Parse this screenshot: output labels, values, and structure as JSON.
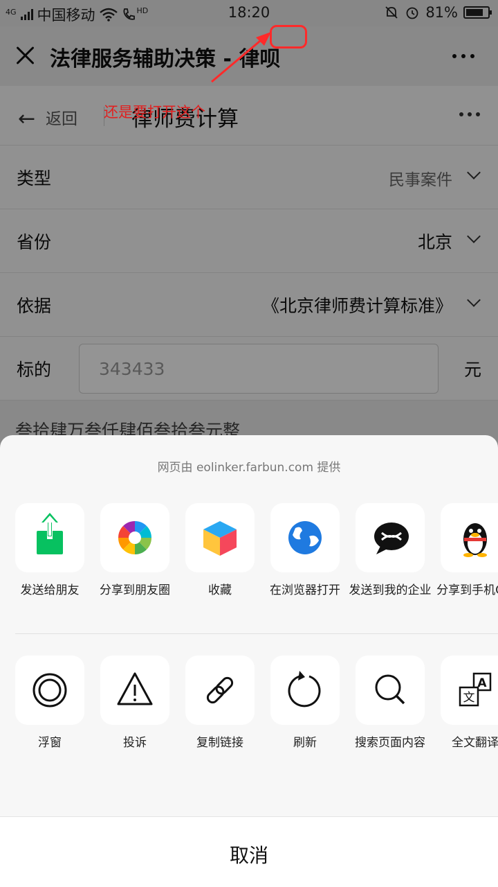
{
  "status_bar": {
    "network_type": "4G",
    "carrier": "中国移动",
    "hd_label": "HD",
    "time": "18:20",
    "battery_percent": "81%",
    "battery_level": 0.81
  },
  "title_bar": {
    "title": "法律服务辅助决策 - 律呗"
  },
  "page_header": {
    "back_label": "返回",
    "title": "律师费计算"
  },
  "annotation": {
    "text": "还是要打开这个",
    "color": "#e02020"
  },
  "form": {
    "type": {
      "label": "类型",
      "value": "民事案件"
    },
    "province": {
      "label": "省份",
      "value": "北京"
    },
    "basis": {
      "label": "依据",
      "value": "《北京律师费计算标准》"
    },
    "amount": {
      "label": "标的",
      "value": "343433",
      "unit": "元"
    },
    "amount_in_words": "叁拾肆万叁仟肆佰叁拾叁元整"
  },
  "share_sheet": {
    "provider_text": "网页由 eolinker.farbun.com 提供",
    "row1": [
      {
        "label": "发送给朋友",
        "icon": "send-to-friend-icon"
      },
      {
        "label": "分享到朋友圈",
        "icon": "moments-icon"
      },
      {
        "label": "收藏",
        "icon": "favorites-cube-icon"
      },
      {
        "label": "在浏览器打开",
        "icon": "browser-globe-icon"
      },
      {
        "label": "发送到我的企业",
        "icon": "enterprise-chat-icon"
      },
      {
        "label": "分享到手机QQ",
        "icon": "qq-penguin-icon"
      }
    ],
    "row2": [
      {
        "label": "浮窗",
        "icon": "floating-window-icon"
      },
      {
        "label": "投诉",
        "icon": "warning-icon"
      },
      {
        "label": "复制链接",
        "icon": "link-icon"
      },
      {
        "label": "刷新",
        "icon": "refresh-icon"
      },
      {
        "label": "搜索页面内容",
        "icon": "search-icon"
      },
      {
        "label": "全文翻译",
        "icon": "translate-icon"
      }
    ],
    "cancel_label": "取消"
  },
  "colors": {
    "wechat_green": "#07c160",
    "annotation_red": "#ff2a2a",
    "globe_blue": "#1f7ae0"
  }
}
